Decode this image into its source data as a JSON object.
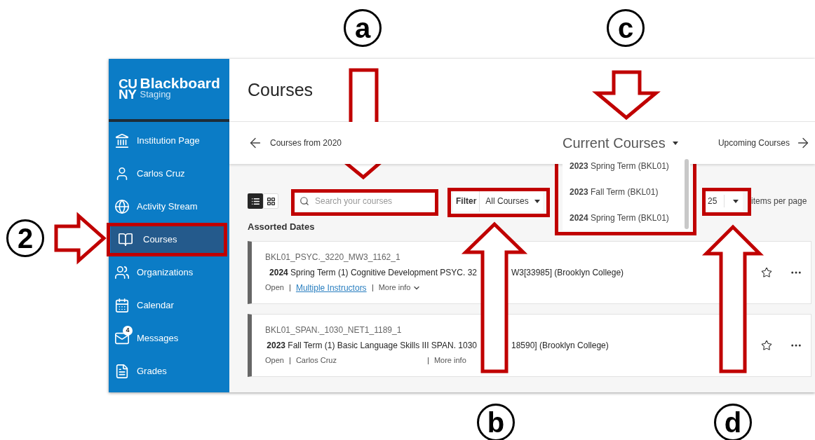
{
  "callouts": [
    {
      "label": "a"
    },
    {
      "label": "c"
    },
    {
      "label": "2"
    },
    {
      "label": "b"
    },
    {
      "label": "d"
    }
  ],
  "sidebar": {
    "logo": {
      "mark_top": "CU",
      "mark_bottom": "NY",
      "name": "Blackboard",
      "subtitle": "Staging"
    },
    "items": [
      {
        "kind": "institution",
        "label": "Institution Page",
        "selected": false
      },
      {
        "kind": "person",
        "label": "Carlos Cruz",
        "selected": false
      },
      {
        "kind": "globe",
        "label": "Activity Stream",
        "selected": false
      },
      {
        "kind": "courses",
        "label": "Courses",
        "selected": true
      },
      {
        "kind": "people",
        "label": "Organizations",
        "selected": false
      },
      {
        "kind": "calendar",
        "label": "Calendar",
        "selected": false
      },
      {
        "kind": "mail",
        "label": "Messages",
        "badge": "4",
        "selected": false
      },
      {
        "kind": "grades",
        "label": "Grades",
        "selected": false
      }
    ]
  },
  "page": {
    "title": "Courses"
  },
  "nav": {
    "previous": "Courses from 2020",
    "current": "Current Courses",
    "next": "Upcoming Courses"
  },
  "term_menu": {
    "options": [
      {
        "label": "**2023** Spring Term (BKL01)"
      },
      {
        "label": "**2023** Fall Term (BKL01)"
      },
      {
        "label": "**2024** Spring Term (BKL01)"
      }
    ]
  },
  "toolbar": {
    "views": [
      {
        "kind": "list",
        "selected": true
      },
      {
        "kind": "grid",
        "selected": false
      }
    ],
    "search": {
      "placeholder": "Search your courses"
    },
    "filter": {
      "label": "Filter",
      "value": "All Courses"
    },
    "page_size": {
      "value": "25",
      "label": "items per page"
    }
  },
  "section": "Assorted Dates",
  "courses": [
    {
      "code": "BKL01_PSYC._3220_MW3_1162_1",
      "title_start": "**2024** Spring Term (1) Cognitive Development PSYC. 32",
      "title_end": "W3[33985] (Brooklyn College)",
      "status": "Open",
      "instructor": "Multiple Instructors",
      "instructor_link": true,
      "more": "More info",
      "more_expandable": true,
      "starred": false
    },
    {
      "code": "BKL01_SPAN._1030_NET1_1189_1",
      "title_start": "**2023** Fall Term (1) Basic Language Skills III SPAN. 1030",
      "title_end": "18590] (Brooklyn College)",
      "status": "Open",
      "instructor": "Carlos Cruz",
      "instructor_link": false,
      "more": "More info",
      "more_expandable": false,
      "starred": false
    }
  ]
}
